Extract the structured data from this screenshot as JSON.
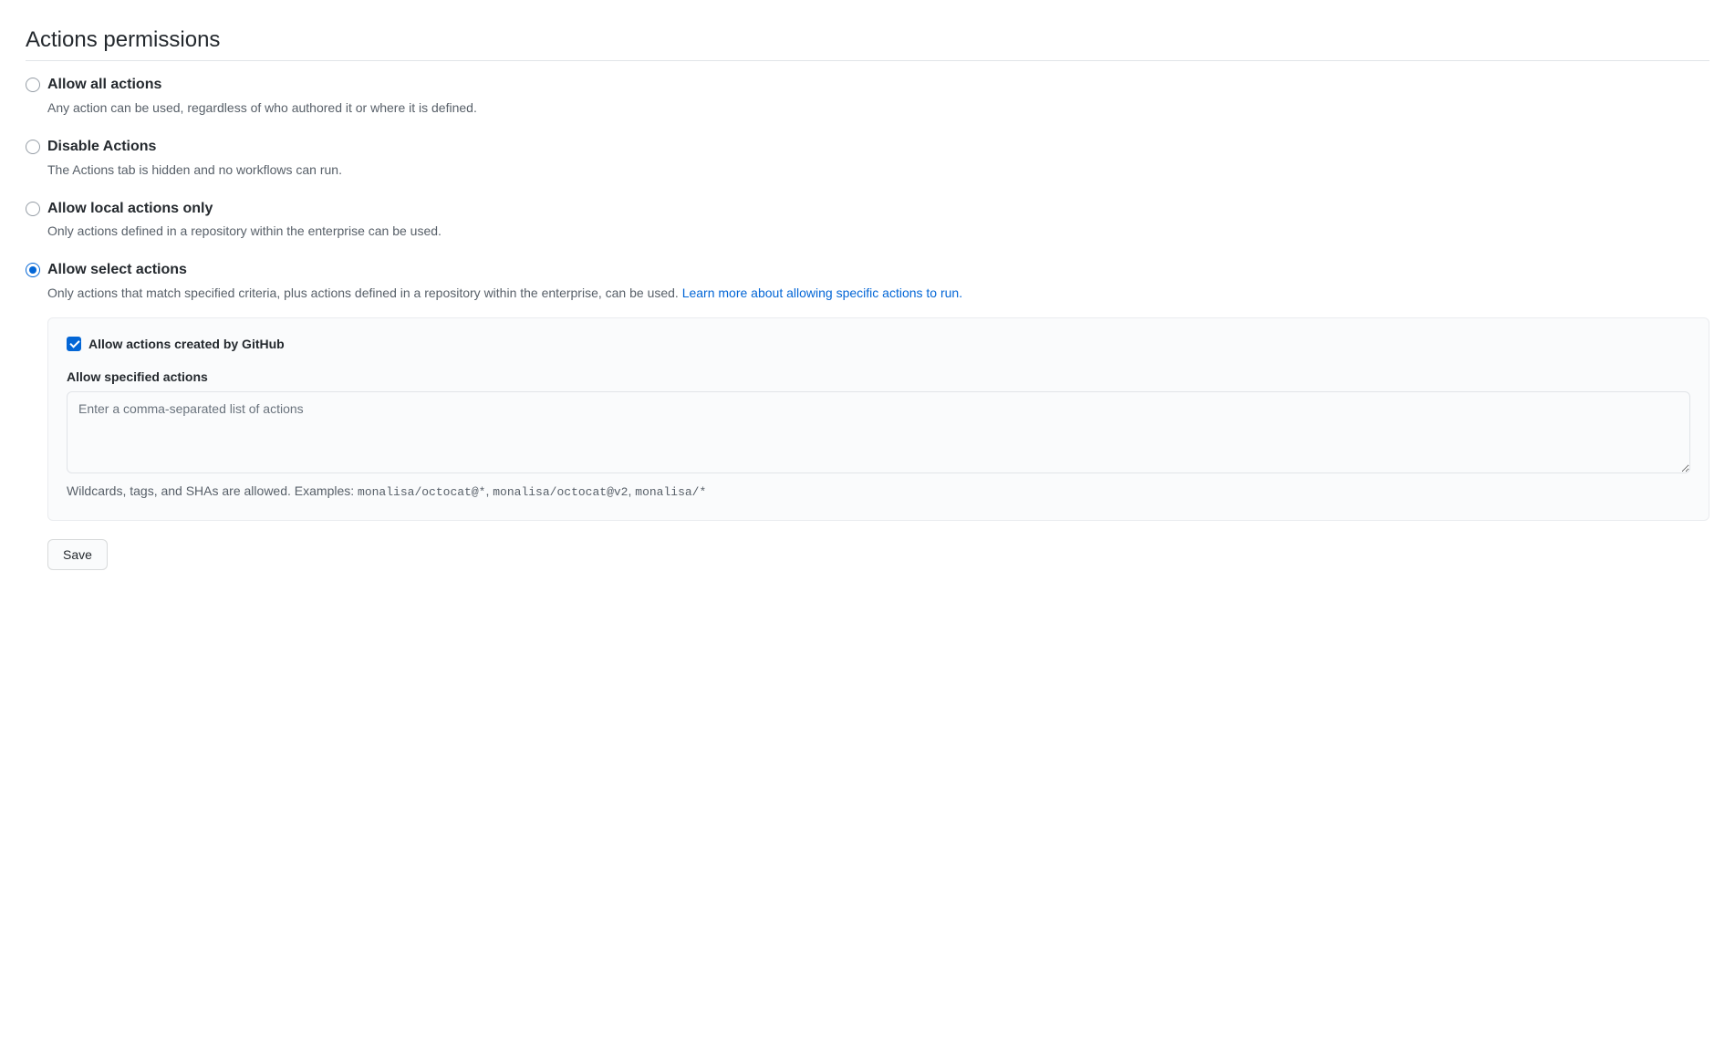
{
  "title": "Actions permissions",
  "options": {
    "allow_all": {
      "label": "Allow all actions",
      "desc": "Any action can be used, regardless of who authored it or where it is defined.",
      "checked": false
    },
    "disable": {
      "label": "Disable Actions",
      "desc": "The Actions tab is hidden and no workflows can run.",
      "checked": false
    },
    "local_only": {
      "label": "Allow local actions only",
      "desc": "Only actions defined in a repository within the enterprise can be used.",
      "checked": false
    },
    "select": {
      "label": "Allow select actions",
      "desc_prefix": "Only actions that match specified criteria, plus actions defined in a repository within the enterprise, can be used. ",
      "link_text": "Learn more about allowing specific actions to run.",
      "checked": true
    }
  },
  "subpanel": {
    "github_checkbox": {
      "label": "Allow actions created by GitHub",
      "checked": true
    },
    "specified": {
      "label": "Allow specified actions",
      "placeholder": "Enter a comma-separated list of actions",
      "value": "",
      "hint_prefix": "Wildcards, tags, and SHAs are allowed. Examples: ",
      "example1": "monalisa/octocat@*",
      "sep1": ", ",
      "example2": "monalisa/octocat@v2",
      "sep2": ", ",
      "example3": "monalisa/*"
    }
  },
  "save_label": "Save"
}
